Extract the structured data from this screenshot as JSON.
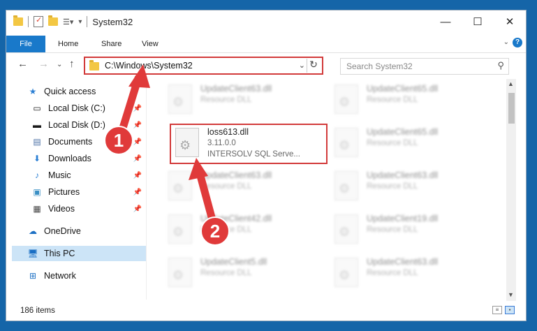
{
  "window": {
    "title": "System32"
  },
  "ribbon": {
    "tabs": [
      "File",
      "Home",
      "Share",
      "View"
    ]
  },
  "address": {
    "path": "C:\\Windows\\System32"
  },
  "search": {
    "placeholder": "Search System32"
  },
  "sidebar": {
    "items": [
      {
        "label": "Quick access",
        "icon": "star-icon"
      },
      {
        "label": "Local Disk (C:)",
        "icon": "drive-icon",
        "pinned": true
      },
      {
        "label": "Local Disk (D:)",
        "icon": "drive-icon",
        "pinned": true
      },
      {
        "label": "Documents",
        "icon": "documents-icon",
        "pinned": true
      },
      {
        "label": "Downloads",
        "icon": "download-icon",
        "pinned": true
      },
      {
        "label": "Music",
        "icon": "music-icon",
        "pinned": true
      },
      {
        "label": "Pictures",
        "icon": "pictures-icon",
        "pinned": true
      },
      {
        "label": "Videos",
        "icon": "videos-icon",
        "pinned": true
      },
      {
        "label": "OneDrive",
        "icon": "cloud-icon"
      },
      {
        "label": "This PC",
        "icon": "computer-icon",
        "selected": true
      },
      {
        "label": "Network",
        "icon": "network-icon"
      }
    ]
  },
  "files": {
    "highlighted": {
      "name": "loss613.dll",
      "version": "3.11.0.0",
      "description": "INTERSOLV SQL Serve..."
    },
    "left_column": [
      {
        "name": "UpdateClient63.dll",
        "description": "Resource DLL"
      },
      {
        "name": "UpdateClient63.dll",
        "description": "Resource DLL"
      },
      {
        "name": "UpdateClient42.dll",
        "description": "Resource DLL"
      },
      {
        "name": "UpdateClient5.dll",
        "description": "Resource DLL"
      }
    ],
    "right_column": [
      {
        "name": "UpdateClient65.dll",
        "description": "Resource DLL"
      },
      {
        "name": "UpdateClient65.dll",
        "description": "Resource DLL"
      },
      {
        "name": "UpdateClient63.dll",
        "description": "Resource DLL"
      },
      {
        "name": "UpdateClient19.dll",
        "description": "Resource DLL"
      },
      {
        "name": "UpdateClient63.dll",
        "description": "Resource DLL"
      }
    ]
  },
  "status": {
    "item_count": "186 items"
  },
  "annotations": {
    "step1": "1",
    "step2": "2",
    "color": "#e03a3a"
  }
}
